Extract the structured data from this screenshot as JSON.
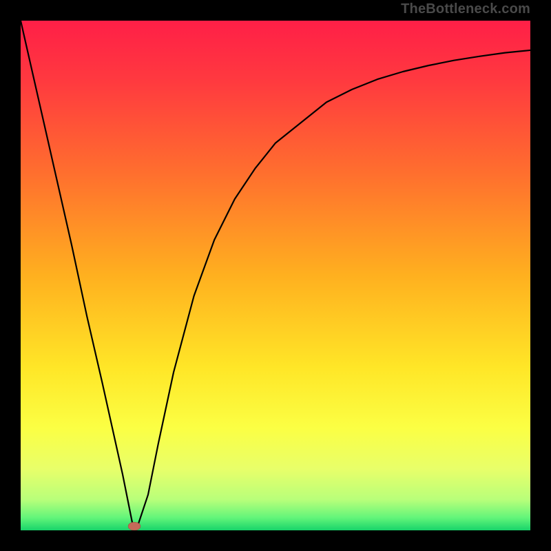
{
  "watermark": "TheBottleneck.com",
  "colors": {
    "gradient_stops": [
      {
        "offset": 0.0,
        "color": "#ff1f47"
      },
      {
        "offset": 0.12,
        "color": "#ff3a3f"
      },
      {
        "offset": 0.3,
        "color": "#ff6f2e"
      },
      {
        "offset": 0.5,
        "color": "#ffb01f"
      },
      {
        "offset": 0.68,
        "color": "#ffe627"
      },
      {
        "offset": 0.8,
        "color": "#fbff44"
      },
      {
        "offset": 0.88,
        "color": "#e8ff6a"
      },
      {
        "offset": 0.94,
        "color": "#b8ff7a"
      },
      {
        "offset": 0.975,
        "color": "#63f57a"
      },
      {
        "offset": 1.0,
        "color": "#18d46a"
      }
    ],
    "curve_stroke": "#000000",
    "marker_fill": "#c46a59",
    "frame_border": "#000000"
  },
  "chart_data": {
    "type": "line",
    "title": "",
    "xlabel": "",
    "ylabel": "",
    "xlim": [
      0,
      100
    ],
    "ylim": [
      0,
      100
    ],
    "grid": false,
    "series": [
      {
        "name": "bottleneck-curve",
        "x": [
          0,
          5,
          10,
          13,
          16,
          18,
          20,
          21,
          22,
          23,
          25,
          27,
          30,
          34,
          38,
          42,
          46,
          50,
          55,
          60,
          65,
          70,
          75,
          80,
          85,
          90,
          95,
          100
        ],
        "values": [
          100,
          78,
          56,
          42,
          29,
          20,
          11,
          6,
          1,
          1,
          7,
          17,
          31,
          46,
          57,
          65,
          71,
          76,
          80,
          84,
          86.5,
          88.5,
          90,
          91.2,
          92.2,
          93,
          93.7,
          94.2
        ]
      }
    ],
    "annotations": [
      {
        "name": "optimum-marker",
        "x": 22.3,
        "y": 0.8,
        "shape": "ellipse",
        "rx": 1.2,
        "ry": 0.8
      }
    ]
  }
}
